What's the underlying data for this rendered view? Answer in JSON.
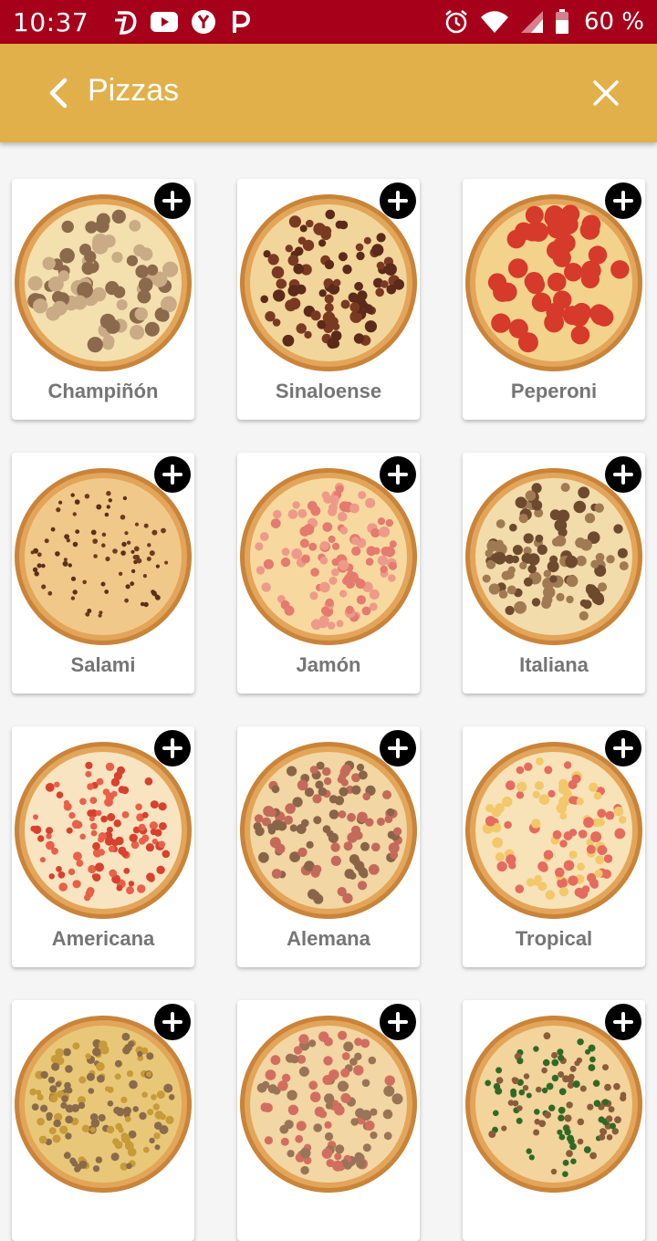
{
  "status_bar": {
    "time": "10:37",
    "battery_percent": "60 %",
    "app_icons": [
      "d-app-icon",
      "youtube-icon",
      "y-app-icon",
      "p-app-icon"
    ],
    "system_icons": [
      "alarm-icon",
      "wifi-icon",
      "signal-icon",
      "battery-icon"
    ]
  },
  "header": {
    "title": "Pizzas",
    "back_icon": "chevron-left-icon",
    "close_icon": "close-icon"
  },
  "colors": {
    "status_bar": "#a6001a",
    "app_bar": "#e2b04a",
    "card_label": "#757575",
    "add_button": "#000000"
  },
  "pizzas": [
    {
      "name": "Champiñón",
      "topping": "mushroom"
    },
    {
      "name": "Sinaloense",
      "topping": "meat"
    },
    {
      "name": "Peperoni",
      "topping": "pepperoni"
    },
    {
      "name": "Salami",
      "topping": "salami-strips"
    },
    {
      "name": "Jamón",
      "topping": "ham"
    },
    {
      "name": "Italiana",
      "topping": "mushroom-sausage"
    },
    {
      "name": "Americana",
      "topping": "pepperoni-bits"
    },
    {
      "name": "Alemana",
      "topping": "mushroom-ham"
    },
    {
      "name": "Tropical",
      "topping": "ham-pineapple"
    },
    {
      "name": "",
      "topping": "corn"
    },
    {
      "name": "",
      "topping": "ham-mushroom"
    },
    {
      "name": "",
      "topping": "peppers"
    }
  ]
}
